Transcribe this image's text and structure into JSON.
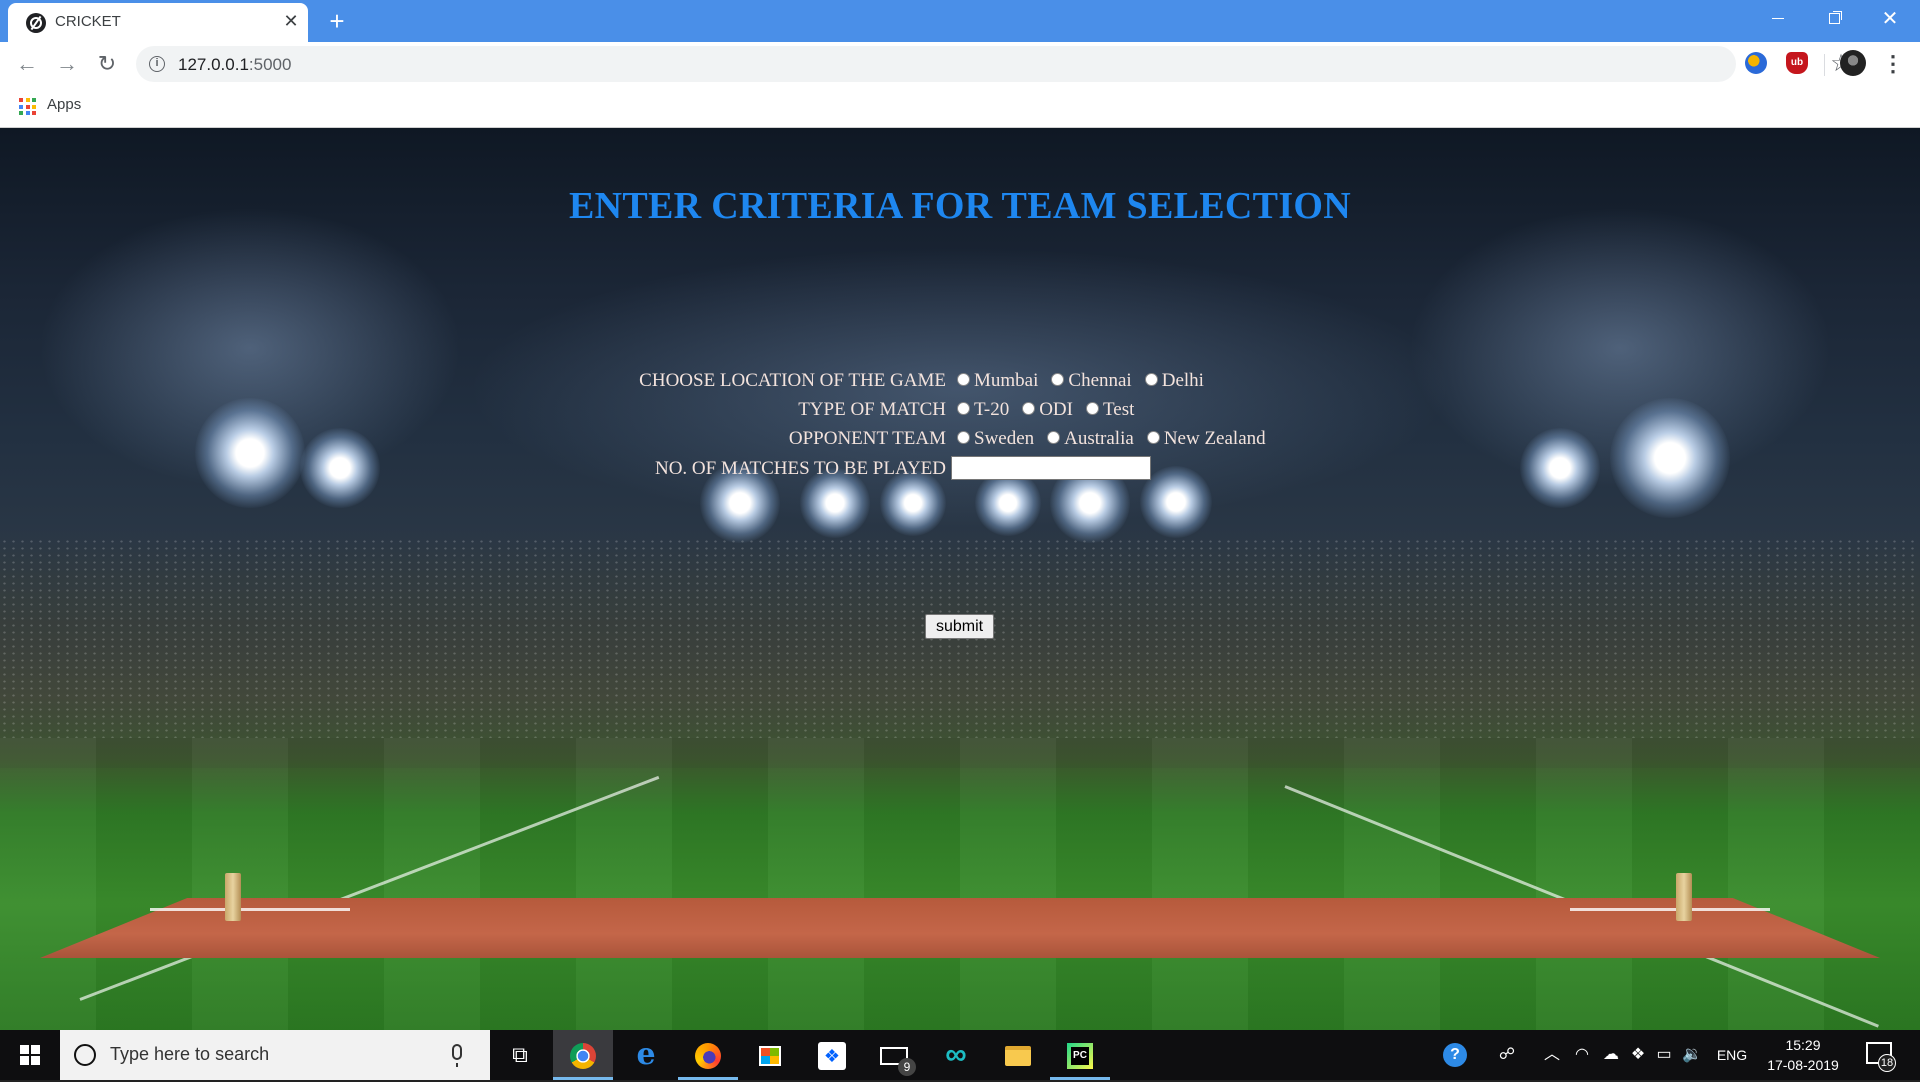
{
  "browser": {
    "tab_title": "CRICKET",
    "tab_close": "✕",
    "new_tab": "+",
    "url_host": "127.0.0.1",
    "url_port": ":5000",
    "bookmarks_apps": "Apps",
    "icons": [
      "back-arrow-icon",
      "forward-arrow-icon",
      "reload-icon",
      "info-icon",
      "star-icon",
      "extension-icon",
      "ublock-icon",
      "avatar",
      "kebab-menu-icon"
    ]
  },
  "page": {
    "heading": "ENTER CRITERIA FOR TEAM SELECTION",
    "location": {
      "label": "CHOOSE LOCATION OF THE GAME",
      "options": [
        "Mumbai",
        "Chennai",
        "Delhi"
      ]
    },
    "match_type": {
      "label": "TYPE OF MATCH",
      "options": [
        "T-20",
        "ODI",
        "Test"
      ]
    },
    "opponent": {
      "label": "OPPONENT TEAM",
      "options": [
        "Sweden",
        "Australia",
        "New Zealand"
      ]
    },
    "matches": {
      "label": "NO. OF MATCHES TO BE PLAYED",
      "value": ""
    },
    "submit_label": "submit",
    "colors": {
      "heading": "#1e87f0",
      "form_text": "#f3e3dd"
    }
  },
  "taskbar": {
    "search_placeholder": "Type here to search",
    "mail_badge": "9",
    "language": "ENG",
    "time": "15:29",
    "date": "17-08-2019",
    "notification_count": "18"
  }
}
